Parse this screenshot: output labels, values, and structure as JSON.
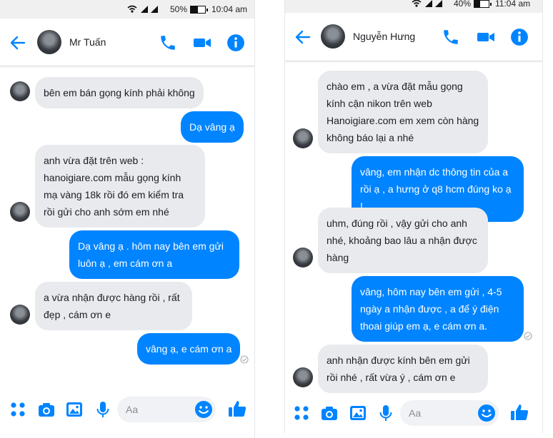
{
  "left": {
    "status": {
      "battery": "50%",
      "time": "10:04 am"
    },
    "contact_name": "Mr Tuấn",
    "messages": [
      "bên em bán gọng kính phải không",
      "Dạ vâng ạ",
      "anh vừa đặt trên web : hanoigiare.com mẫu gọng kính mạ vàng 18k rồi đó em kiểm tra rồi gửi cho anh sớm em nhé",
      "Dạ vâng ạ . hôm nay bên em gửi luôn ạ , em cám ơn a",
      "a vừa nhận được hàng rồi , rất đẹp , cám ơn e",
      "vâng ạ, e cám ơn a"
    ],
    "composer_placeholder": "Aa"
  },
  "right": {
    "status": {
      "battery": "40%",
      "time": "11:04 am"
    },
    "contact_name": "Nguyễn Hưng",
    "messages": [
      "chào em , a vừa đặt mẫu gọng kính cận nikon trên web Hanoigiare.com em xem còn hàng không báo lại a nhé",
      "vâng, em nhận dc thông tin của a rồi ạ , a hưng ở q8 hcm đúng ko ạ !",
      "uhm, đúng rồi , vậy gửi cho anh nhé, khoảng bao lâu a nhận được hàng",
      "vâng, hôm nay bên em gửi , 4-5 ngày a nhận được , a để ý điện thoai giúp em ạ, e cám ơn a.",
      "anh nhận được kính bên em gửi rồi nhé , rất vừa ý , cám ơn e"
    ],
    "composer_placeholder": "Aa"
  },
  "colors": {
    "accent": "#0084ff",
    "incoming_bubble": "#e9eaed"
  },
  "icons": [
    "back-arrow",
    "phone",
    "video-camera",
    "info",
    "apps-grid",
    "camera",
    "image",
    "microphone",
    "emoji-smile",
    "thumbs-up",
    "wifi",
    "cell-signal",
    "battery",
    "seen-check"
  ]
}
